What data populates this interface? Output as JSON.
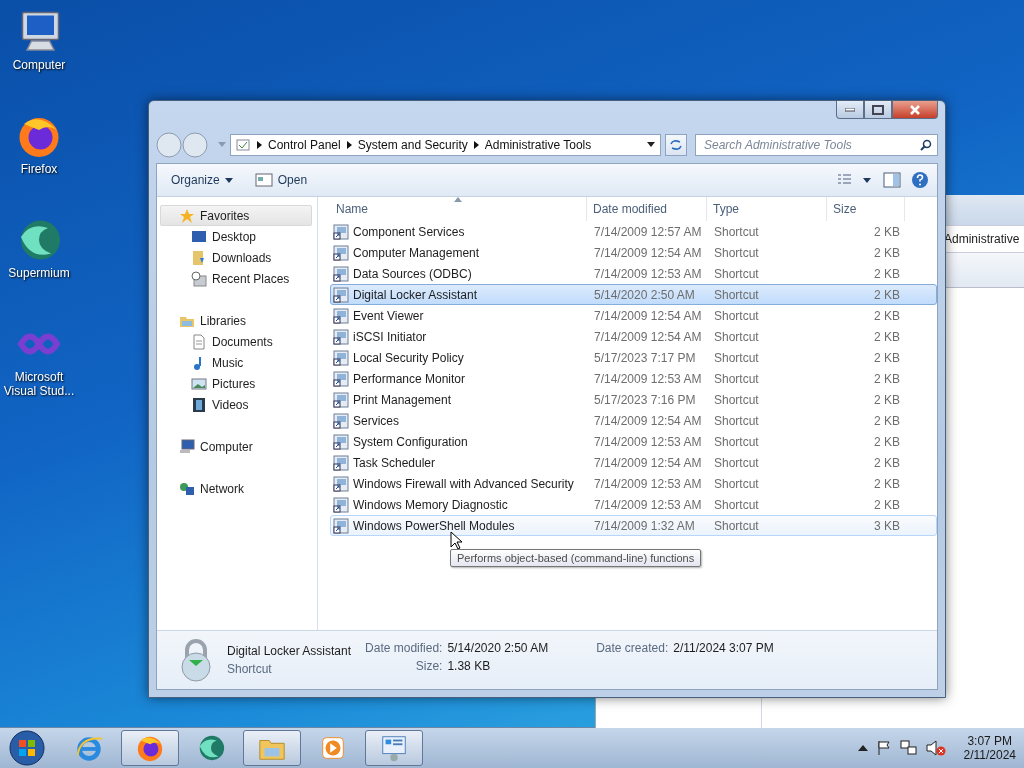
{
  "desktop_icons": [
    {
      "label": "Computer",
      "kind": "computer"
    },
    {
      "label": "Firefox",
      "kind": "firefox"
    },
    {
      "label": "Supermium",
      "kind": "supermium"
    },
    {
      "label": "Microsoft Visual Stud...",
      "kind": "visualstudio"
    }
  ],
  "background_window": {
    "text": "Administrative"
  },
  "explorer": {
    "address": {
      "crumbs": [
        "Control Panel",
        "System and Security",
        "Administrative Tools"
      ]
    },
    "search": {
      "placeholder": "Search Administrative Tools"
    },
    "toolbar": [
      {
        "label": "Organize",
        "kind": "menu"
      },
      {
        "label": "Open",
        "kind": "open"
      }
    ],
    "sidebar": [
      {
        "label": "Favorites",
        "kind": "star",
        "selected": true,
        "children": [
          {
            "label": "Desktop",
            "kind": "desktop",
            "selected": false
          },
          {
            "label": "Downloads",
            "kind": "downloads",
            "selected": false
          },
          {
            "label": "Recent Places",
            "kind": "recent",
            "selected": false
          }
        ]
      },
      {
        "label": "Libraries",
        "kind": "library",
        "selected": false,
        "children": [
          {
            "label": "Documents",
            "kind": "documents",
            "selected": false
          },
          {
            "label": "Music",
            "kind": "music",
            "selected": false
          },
          {
            "label": "Pictures",
            "kind": "pictures",
            "selected": false
          },
          {
            "label": "Videos",
            "kind": "videos",
            "selected": false
          }
        ]
      },
      {
        "label": "Computer",
        "kind": "computer",
        "selected": false
      },
      {
        "label": "Network",
        "kind": "network",
        "selected": false
      }
    ],
    "columns": [
      {
        "label": "Name",
        "sorted": true
      },
      {
        "label": "Date modified",
        "sorted": false
      },
      {
        "label": "Type",
        "sorted": false
      },
      {
        "label": "Size",
        "sorted": false
      }
    ],
    "rows": [
      {
        "name": "Component Services",
        "date": "7/14/2009 12:57 AM",
        "type": "Shortcut",
        "size": "2 KB",
        "selected": false,
        "hovered": false
      },
      {
        "name": "Computer Management",
        "date": "7/14/2009 12:54 AM",
        "type": "Shortcut",
        "size": "2 KB",
        "selected": false,
        "hovered": false
      },
      {
        "name": "Data Sources (ODBC)",
        "date": "7/14/2009 12:53 AM",
        "type": "Shortcut",
        "size": "2 KB",
        "selected": false,
        "hovered": false
      },
      {
        "name": "Digital Locker Assistant",
        "date": "5/14/2020 2:50 AM",
        "type": "Shortcut",
        "size": "2 KB",
        "selected": true,
        "hovered": false
      },
      {
        "name": "Event Viewer",
        "date": "7/14/2009 12:54 AM",
        "type": "Shortcut",
        "size": "2 KB",
        "selected": false,
        "hovered": false
      },
      {
        "name": "iSCSI Initiator",
        "date": "7/14/2009 12:54 AM",
        "type": "Shortcut",
        "size": "2 KB",
        "selected": false,
        "hovered": false
      },
      {
        "name": "Local Security Policy",
        "date": "5/17/2023 7:17 PM",
        "type": "Shortcut",
        "size": "2 KB",
        "selected": false,
        "hovered": false
      },
      {
        "name": "Performance Monitor",
        "date": "7/14/2009 12:53 AM",
        "type": "Shortcut",
        "size": "2 KB",
        "selected": false,
        "hovered": false
      },
      {
        "name": "Print Management",
        "date": "5/17/2023 7:16 PM",
        "type": "Shortcut",
        "size": "2 KB",
        "selected": false,
        "hovered": false
      },
      {
        "name": "Services",
        "date": "7/14/2009 12:54 AM",
        "type": "Shortcut",
        "size": "2 KB",
        "selected": false,
        "hovered": false
      },
      {
        "name": "System Configuration",
        "date": "7/14/2009 12:53 AM",
        "type": "Shortcut",
        "size": "2 KB",
        "selected": false,
        "hovered": false
      },
      {
        "name": "Task Scheduler",
        "date": "7/14/2009 12:54 AM",
        "type": "Shortcut",
        "size": "2 KB",
        "selected": false,
        "hovered": false
      },
      {
        "name": "Windows Firewall with Advanced Security",
        "date": "7/14/2009 12:53 AM",
        "type": "Shortcut",
        "size": "2 KB",
        "selected": false,
        "hovered": false
      },
      {
        "name": "Windows Memory Diagnostic",
        "date": "7/14/2009 12:53 AM",
        "type": "Shortcut",
        "size": "2 KB",
        "selected": false,
        "hovered": false
      },
      {
        "name": "Windows PowerShell Modules",
        "date": "7/14/2009 1:32 AM",
        "type": "Shortcut",
        "size": "3 KB",
        "selected": false,
        "hovered": true
      }
    ],
    "tooltip": "Performs object-based (command-line) functions",
    "details": {
      "name": "Digital Locker Assistant",
      "type": "Shortcut",
      "fields": [
        {
          "label": "Date modified:",
          "value": "5/14/2020 2:50 AM"
        },
        {
          "label": "Date created:",
          "value": "2/11/2024 3:07 PM"
        },
        {
          "label": "Size:",
          "value": "1.38 KB"
        }
      ]
    }
  },
  "taskbar": {
    "items": [
      {
        "kind": "ie",
        "running": false
      },
      {
        "kind": "firefox",
        "running": true
      },
      {
        "kind": "supermium",
        "running": false
      },
      {
        "kind": "explorer",
        "running": true
      },
      {
        "kind": "media",
        "running": false
      },
      {
        "kind": "controlpanel",
        "running": true
      }
    ],
    "time": "3:07 PM",
    "date": "2/11/2024"
  }
}
